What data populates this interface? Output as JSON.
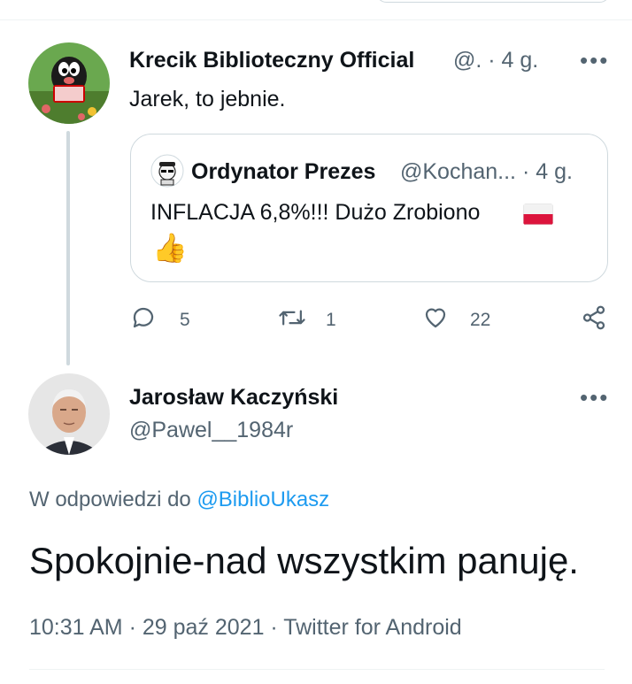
{
  "tweet1": {
    "name": "Krecik Biblioteczny Official",
    "meta": "@. · 4 g.",
    "more": "•••",
    "text": "Jarek, to jebnie.",
    "quote": {
      "name": "Ordynator Prezes",
      "meta": "@Kochan... · 4 g.",
      "text": "INFLACJA 6,8%!!! Dużo Zrobiono",
      "emoji": "👍"
    },
    "actions": {
      "replies": "5",
      "retweets": "1",
      "likes": "22"
    }
  },
  "tweet2": {
    "name": "Jarosław Kaczyński",
    "handle": "@Pawel__1984r",
    "more": "•••",
    "reply_prefix": "W odpowiedzi do",
    "reply_to": "@BiblioUkasz",
    "text": "Spokojnie-nad wszystkim panuję.",
    "footer": "10:31 AM · 29 paź 2021 · Twitter for Android"
  },
  "colors": {
    "text": "#0f1419",
    "muted": "#536471",
    "link": "#1d9bf0",
    "border": "#cfd9de"
  }
}
